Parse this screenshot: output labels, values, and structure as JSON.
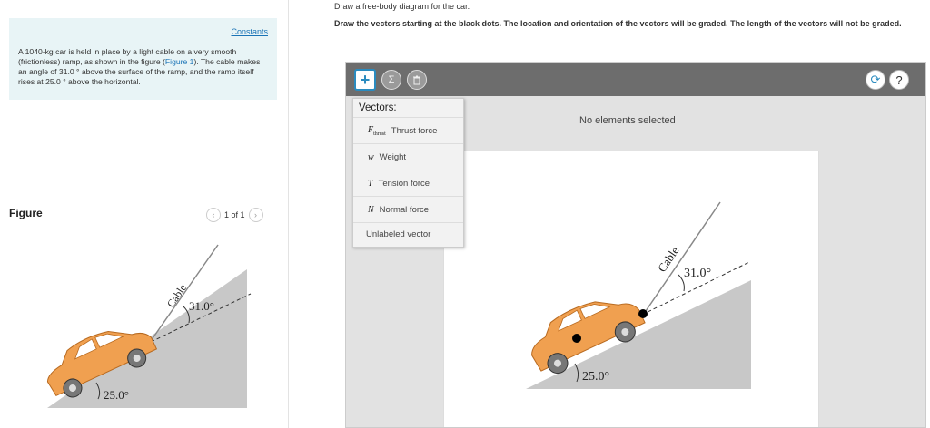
{
  "problem": {
    "constants_link": "Constants",
    "text_before": "A 1040-kg car is held in place by a light cable on a very smooth (frictionless) ramp, as shown in the figure (",
    "figure_link": "Figure 1",
    "text_after": "). The cable makes an angle of 31.0 ° above the surface of the ramp, and the ramp itself rises at 25.0 ° above the horizontal."
  },
  "figure_panel": {
    "label": "Figure",
    "pager_text": "1 of 1",
    "prev_icon": "chevron-left-icon",
    "next_icon": "chevron-right-icon"
  },
  "figure": {
    "cable_label": "Cable",
    "cable_angle": "31.0°",
    "ramp_angle": "25.0°",
    "car_color": "#f0a050",
    "ramp_color": "#c8c8c8"
  },
  "instructions": {
    "line1": "Draw a free-body diagram for the car.",
    "line2": "Draw the vectors starting at the black dots. The location and orientation of the vectors will be graded. The length of the vectors will not be graded."
  },
  "tool": {
    "add_icon": "plus-icon",
    "sigma_icon": "sigma-icon",
    "trash_icon": "trash-icon",
    "reset_icon": "reset-icon",
    "help_icon": "help-icon",
    "status": "No elements selected",
    "accent_color": "#2a8bbf",
    "vector_menu": {
      "title": "Vectors:",
      "items": [
        {
          "symbol": "F",
          "subscript": "thrust",
          "label": "Thrust force"
        },
        {
          "symbol": "w",
          "subscript": "",
          "label": "Weight"
        },
        {
          "symbol": "T",
          "subscript": "",
          "label": "Tension force"
        },
        {
          "symbol": "N",
          "subscript": "",
          "label": "Normal force"
        }
      ],
      "unlabeled": "Unlabeled vector"
    }
  }
}
